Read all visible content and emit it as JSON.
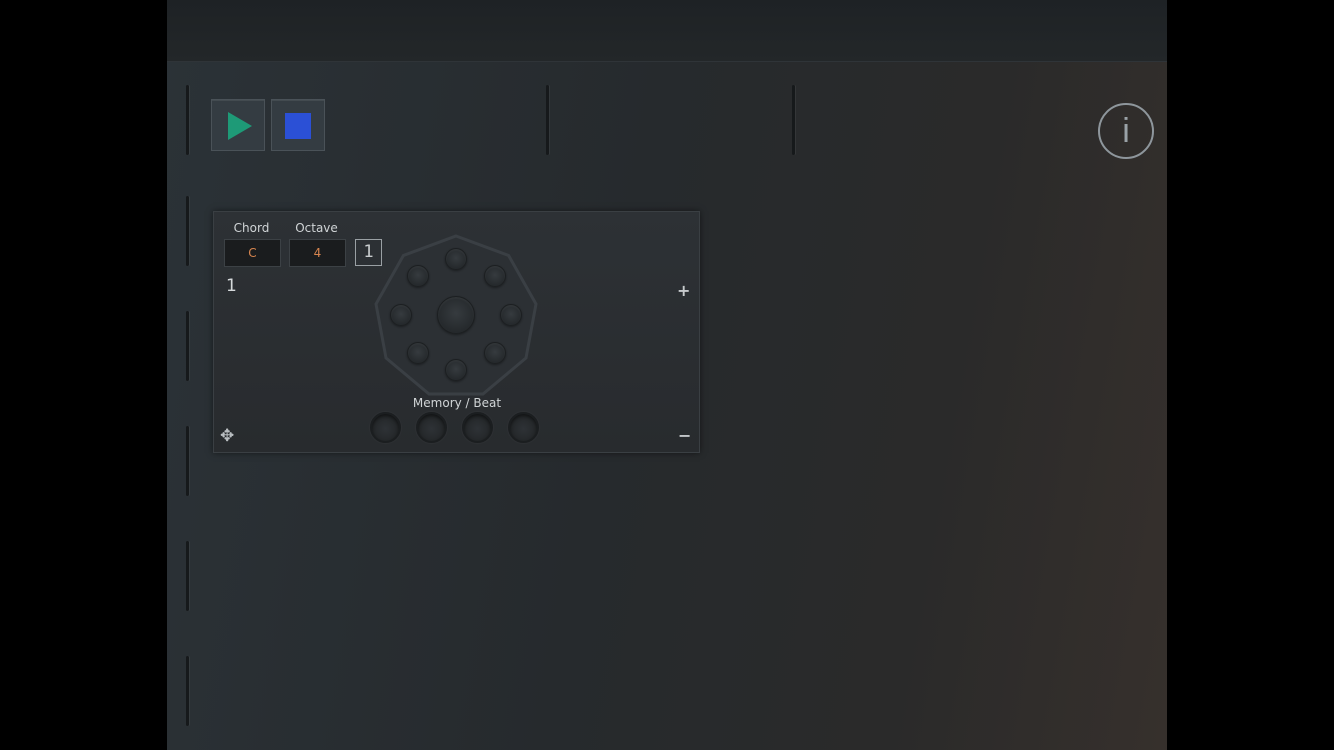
{
  "transport": {
    "play_icon": "play-icon",
    "stop_icon": "stop-icon",
    "play_color": "#1e9a77",
    "stop_color": "#2b50d6"
  },
  "info": {
    "label": "i"
  },
  "panel": {
    "chord_label": "Chord",
    "chord_value": "C",
    "octave_label": "Octave",
    "octave_value": "4",
    "voice_badge": "1",
    "step_number": "1",
    "plus": "+",
    "minus": "−",
    "move_icon": "move-icon",
    "memory_label": "Memory / Beat",
    "value_color": "#d7854f"
  }
}
